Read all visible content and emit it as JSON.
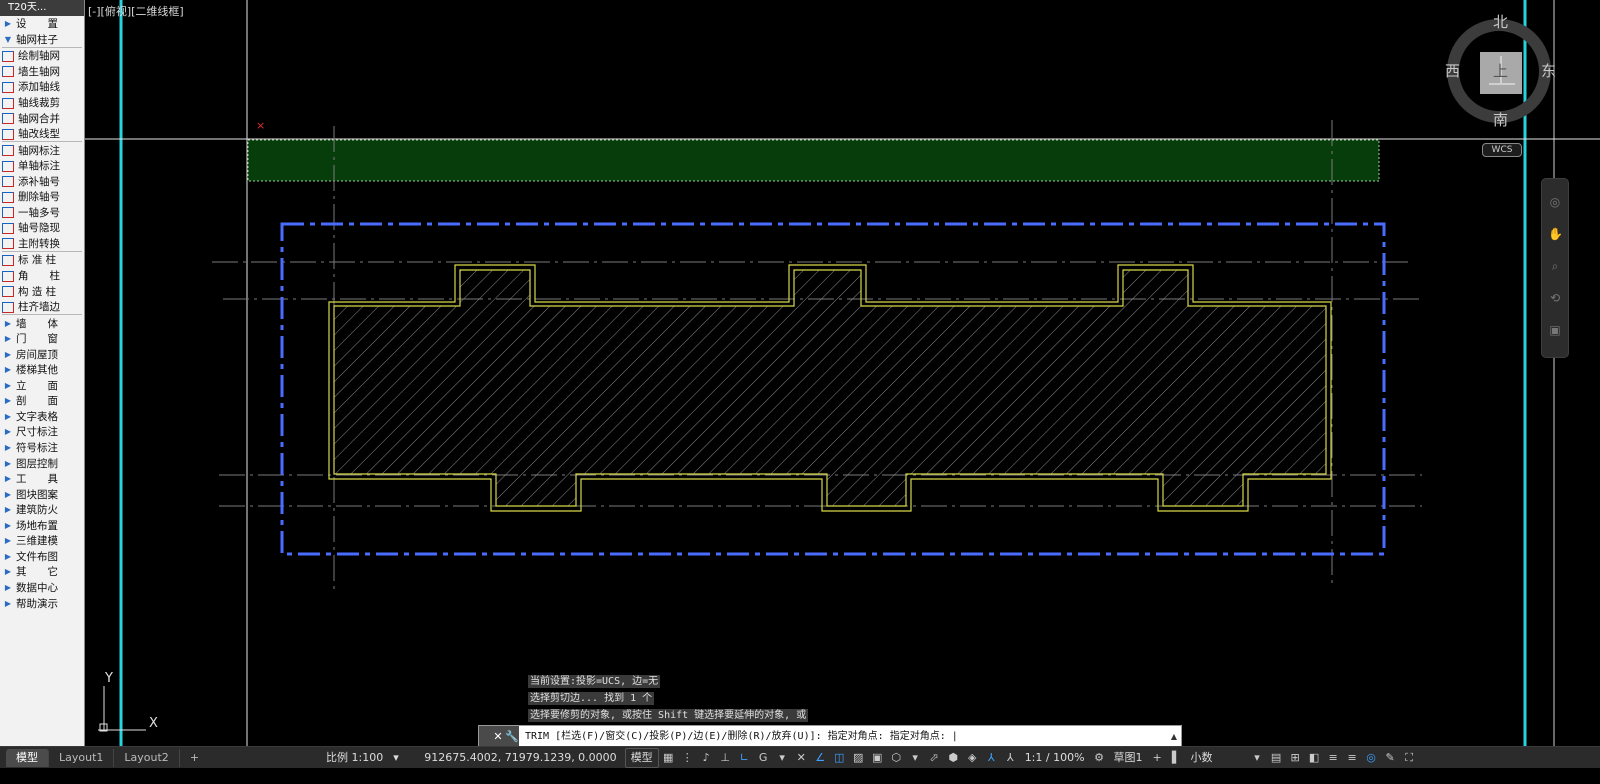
{
  "palette": {
    "title": "T20天...",
    "items": [
      {
        "label": "设　　置",
        "kind": "group"
      },
      {
        "label": "轴网柱子",
        "kind": "group-open"
      },
      {
        "sep": true
      },
      {
        "label": "绘制轴网",
        "kind": "tool"
      },
      {
        "label": "墙生轴网",
        "kind": "tool"
      },
      {
        "label": "添加轴线",
        "kind": "tool"
      },
      {
        "label": "轴线裁剪",
        "kind": "tool"
      },
      {
        "label": "轴网合并",
        "kind": "tool"
      },
      {
        "label": "轴改线型",
        "kind": "tool"
      },
      {
        "sep": true
      },
      {
        "label": "轴网标注",
        "kind": "tool"
      },
      {
        "label": "单轴标注",
        "kind": "tool"
      },
      {
        "label": "添补轴号",
        "kind": "tool"
      },
      {
        "label": "删除轴号",
        "kind": "tool"
      },
      {
        "label": "一轴多号",
        "kind": "tool"
      },
      {
        "label": "轴号隐现",
        "kind": "tool"
      },
      {
        "label": "主附转换",
        "kind": "tool"
      },
      {
        "sep": true
      },
      {
        "label": "标 准 柱",
        "kind": "tool"
      },
      {
        "label": "角　　柱",
        "kind": "tool"
      },
      {
        "label": "构 造 柱",
        "kind": "tool"
      },
      {
        "label": "柱齐墙边",
        "kind": "tool"
      },
      {
        "sep": true
      },
      {
        "label": "墙　　体",
        "kind": "group"
      },
      {
        "label": "门　　窗",
        "kind": "group"
      },
      {
        "label": "房间屋顶",
        "kind": "group"
      },
      {
        "label": "楼梯其他",
        "kind": "group"
      },
      {
        "label": "立　　面",
        "kind": "group"
      },
      {
        "label": "剖　　面",
        "kind": "group"
      },
      {
        "label": "文字表格",
        "kind": "group"
      },
      {
        "label": "尺寸标注",
        "kind": "group"
      },
      {
        "label": "符号标注",
        "kind": "group"
      },
      {
        "label": "图层控制",
        "kind": "group"
      },
      {
        "label": "工　　具",
        "kind": "group"
      },
      {
        "label": "图块图案",
        "kind": "group"
      },
      {
        "label": "建筑防火",
        "kind": "group"
      },
      {
        "label": "场地布置",
        "kind": "group"
      },
      {
        "label": "三维建模",
        "kind": "group"
      },
      {
        "label": "文件布图",
        "kind": "group"
      },
      {
        "label": "其　　它",
        "kind": "group"
      },
      {
        "label": "数据中心",
        "kind": "group"
      },
      {
        "label": "帮助演示",
        "kind": "group"
      }
    ]
  },
  "viewport": {
    "label": "[-][俯视][二维线框]"
  },
  "viewcube": {
    "north": "北",
    "south": "南",
    "east": "东",
    "west": "西",
    "face": "上",
    "wcs": "WCS"
  },
  "ucs": {
    "x": "X",
    "y": "Y"
  },
  "colors": {
    "hatch_outline": "#d8d84a",
    "grid_blue": "#4a6cff",
    "cyan": "#27d3dc",
    "green_fill": "#063d0a"
  },
  "command": {
    "history": [
      "当前设置:投影=UCS, 边=无",
      "选择剪切边... 找到 1 个",
      "选择要修剪的对象, 或按住 Shift 键选择要延伸的对象, 或"
    ],
    "prompt": "TRIM [栏选(F)/窗交(C)/投影(P)/边(E)/删除(R)/放弃(U)]:  指定对角点: 指定对角点: |"
  },
  "status": {
    "tabs": [
      "模型",
      "Layout1",
      "Layout2"
    ],
    "scale": "比例 1:100",
    "coords": "912675.4002, 71979.1239, 0.0000",
    "space": "模型",
    "annotation_scale": "1:1 / 100%",
    "workspace": "草图1",
    "units": "小数"
  }
}
